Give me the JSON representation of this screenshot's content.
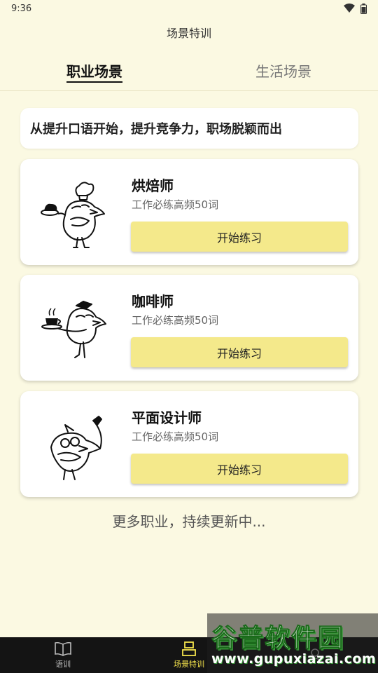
{
  "status_bar": {
    "time": "9:36",
    "icons": [
      "wifi-icon",
      "battery-icon"
    ]
  },
  "app_title": "场景特训",
  "tabs": [
    {
      "label": "职业场景",
      "active": true
    },
    {
      "label": "生活场景",
      "active": false
    }
  ],
  "headline": "从提升口语开始，提升竞争力，职场脱颖而出",
  "cards": [
    {
      "title": "烘焙师",
      "subtitle": "工作必练高频50词",
      "button": "开始练习",
      "icon": "baker-bird-illustration"
    },
    {
      "title": "咖啡师",
      "subtitle": "工作必练高频50词",
      "button": "开始练习",
      "icon": "barista-bird-illustration"
    },
    {
      "title": "平面设计师",
      "subtitle": "工作必练高频50词",
      "button": "开始练习",
      "icon": "designer-bird-illustration"
    }
  ],
  "more_text": "更多职业，持续更新中...",
  "bottom_nav": [
    {
      "label": "语训",
      "icon": "book-icon",
      "active": false
    },
    {
      "label": "场景特训",
      "icon": "scenario-icon",
      "active": true
    },
    {
      "label": "",
      "icon": "profile-icon",
      "active": false
    }
  ],
  "watermark": {
    "name": "谷普软件园",
    "url": "www.gupuxiazai.com"
  },
  "colors": {
    "background": "#fbf9e2",
    "button": "#f4e98b",
    "nav_bg": "#141414",
    "nav_active": "#f3e24c"
  }
}
